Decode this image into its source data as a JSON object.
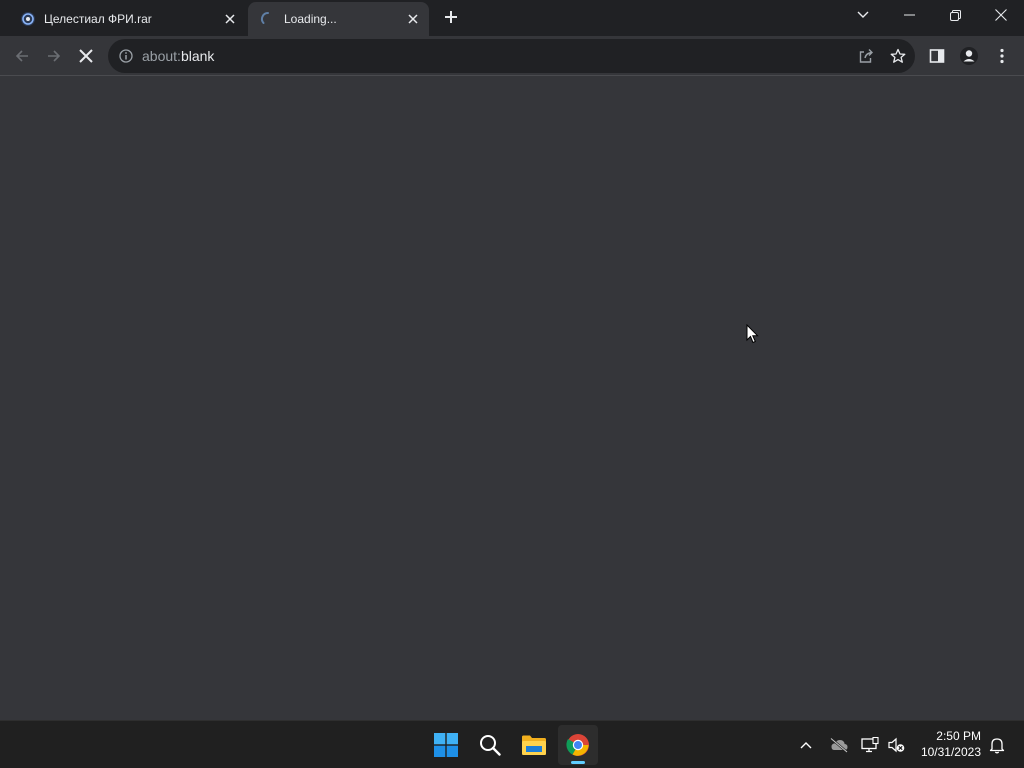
{
  "browser": {
    "tabs": [
      {
        "title": "Целестиал ФРИ.rar",
        "favicon": "web-app-icon",
        "state": "inactive"
      },
      {
        "title": "Loading...",
        "favicon": "loading-spinner-icon",
        "state": "active"
      }
    ],
    "omnibox": {
      "scheme": "about:",
      "host": "blank"
    }
  },
  "taskbar": {
    "apps": [
      "windows-start-icon",
      "search-icon",
      "file-explorer-icon",
      "chrome-icon"
    ],
    "active_app": "chrome-icon",
    "clock": {
      "time": "2:50 PM",
      "date": "10/31/2023"
    }
  },
  "colors": {
    "tabstrip": "#202124",
    "toolbar": "#35363a",
    "omnibox": "#202124",
    "taskbar": "#202020",
    "accent": "#60cdff"
  }
}
